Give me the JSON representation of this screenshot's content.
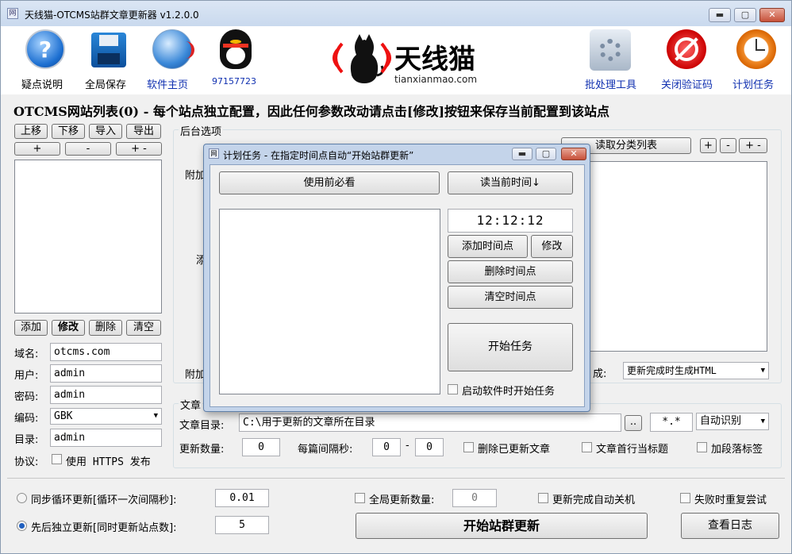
{
  "window": {
    "title": "天线猫-OTCMS站群文章更新器 v1.2.0.0",
    "app_icon": "网",
    "min": "▬",
    "max": "▢",
    "close": "✕"
  },
  "toolbar": {
    "help": "疑点说明",
    "save": "全局保存",
    "home": "软件主页",
    "qq": "97157723",
    "batch": "批处理工具",
    "captcha": "关闭验证码",
    "schedule": "计划任务"
  },
  "logo": {
    "cn": "天线猫",
    "en": "tianxianmao.com"
  },
  "heading": "OTCMS网站列表(0) - 每个站点独立配置，因此任何参数改动请点击[修改]按钮来保存当前配置到该站点",
  "sitelist": {
    "up": "上移",
    "down": "下移",
    "import": "导入",
    "export": "导出",
    "plus": "+",
    "minus": "-",
    "plusminus": "+ -",
    "add": "添加",
    "edit": "修改",
    "del": "删除",
    "clear": "清空"
  },
  "form": {
    "domain_label": "域名:",
    "domain": "otcms.com",
    "user_label": "用户:",
    "user": "admin",
    "pwd_label": "密码:",
    "pwd": "admin",
    "enc_label": "编码:",
    "enc": "GBK",
    "dir_label": "目录:",
    "dir": "admin",
    "proto_label": "协议:",
    "https": "使用 HTTPS 发布"
  },
  "backend": {
    "group": "后台选项",
    "attach1": "附加",
    "mid": "添",
    "attach2": "附加",
    "read_cats": "读取分类列表",
    "gen_label": "成:",
    "gen": "更新完成时生成HTML"
  },
  "article": {
    "group": "文章",
    "dir_label": "文章目录:",
    "dir": "C:\\用于更新的文章所在目录",
    "browse": "..",
    "ext": "*.*",
    "encoding": "自动识别",
    "count_label": "更新数量:",
    "count": "0",
    "interval_label": "每篇间隔秒:",
    "int_from": "0",
    "dash": "-",
    "int_to": "0",
    "del_updated": "删除已更新文章",
    "first_line_title": "文章首行当标题",
    "para_tag": "加段落标签"
  },
  "bottom": {
    "sync_loop": "同步循环更新[循环一次间隔秒]:",
    "sync_val": "0.01",
    "seq": "先后独立更新[同时更新站点数]:",
    "seq_val": "5",
    "global_count": "全局更新数量:",
    "global_val": "0",
    "auto_shutdown": "更新完成自动关机",
    "retry": "失败时重复尝试",
    "start": "开始站群更新",
    "log": "查看日志"
  },
  "dialog": {
    "title": "计划任务 - 在指定时间点自动“开始站群更新”",
    "must_read": "使用前必看",
    "read_time": "读当前时间↓",
    "time": "12:12:12",
    "add_time": "添加时间点",
    "edit": "修改",
    "del_time": "删除时间点",
    "clear_time": "清空时间点",
    "start_task": "开始任务",
    "autostart": "启动软件时开始任务"
  }
}
